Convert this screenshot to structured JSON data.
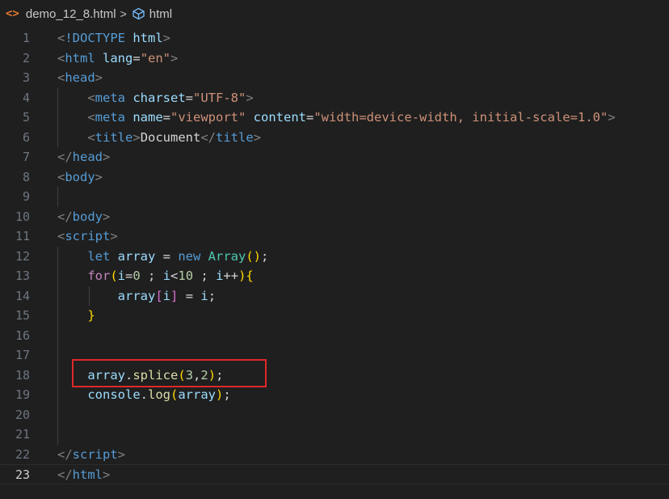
{
  "breadcrumb": {
    "file_icon": "<>",
    "file_name": "demo_12_8.html",
    "separator": ">",
    "element_name": "html"
  },
  "editor": {
    "current_line": 23,
    "highlighted_line": 18,
    "lines": [
      {
        "n": "1",
        "tokens": [
          [
            "t-punct",
            "<"
          ],
          [
            "t-doctype",
            "!DOCTYPE "
          ],
          [
            "t-attr",
            "html"
          ],
          [
            "t-punct",
            ">"
          ]
        ]
      },
      {
        "n": "2",
        "tokens": [
          [
            "t-punct",
            "<"
          ],
          [
            "t-tag",
            "html "
          ],
          [
            "t-attr",
            "lang"
          ],
          [
            "t-text",
            "="
          ],
          [
            "t-str",
            "\"en\""
          ],
          [
            "t-punct",
            ">"
          ]
        ]
      },
      {
        "n": "3",
        "tokens": [
          [
            "t-punct",
            "<"
          ],
          [
            "t-tag",
            "head"
          ],
          [
            "t-punct",
            ">"
          ]
        ]
      },
      {
        "n": "4",
        "tokens": [
          [
            "t-text",
            "    "
          ],
          [
            "t-punct",
            "<"
          ],
          [
            "t-tag",
            "meta "
          ],
          [
            "t-attr",
            "charset"
          ],
          [
            "t-text",
            "="
          ],
          [
            "t-str",
            "\"UTF-8\""
          ],
          [
            "t-punct",
            ">"
          ]
        ]
      },
      {
        "n": "5",
        "tokens": [
          [
            "t-text",
            "    "
          ],
          [
            "t-punct",
            "<"
          ],
          [
            "t-tag",
            "meta "
          ],
          [
            "t-attr",
            "name"
          ],
          [
            "t-text",
            "="
          ],
          [
            "t-str",
            "\"viewport\" "
          ],
          [
            "t-attr",
            "content"
          ],
          [
            "t-text",
            "="
          ],
          [
            "t-str",
            "\"width=device-width, initial-scale=1.0\""
          ],
          [
            "t-punct",
            ">"
          ]
        ]
      },
      {
        "n": "6",
        "tokens": [
          [
            "t-text",
            "    "
          ],
          [
            "t-punct",
            "<"
          ],
          [
            "t-tag",
            "title"
          ],
          [
            "t-punct",
            ">"
          ],
          [
            "t-text",
            "Document"
          ],
          [
            "t-punct",
            "</"
          ],
          [
            "t-tag",
            "title"
          ],
          [
            "t-punct",
            ">"
          ]
        ]
      },
      {
        "n": "7",
        "tokens": [
          [
            "t-punct",
            "</"
          ],
          [
            "t-tag",
            "head"
          ],
          [
            "t-punct",
            ">"
          ]
        ]
      },
      {
        "n": "8",
        "tokens": [
          [
            "t-punct",
            "<"
          ],
          [
            "t-tag",
            "body"
          ],
          [
            "t-punct",
            ">"
          ]
        ]
      },
      {
        "n": "9",
        "tokens": []
      },
      {
        "n": "10",
        "tokens": [
          [
            "t-punct",
            "</"
          ],
          [
            "t-tag",
            "body"
          ],
          [
            "t-punct",
            ">"
          ]
        ]
      },
      {
        "n": "11",
        "tokens": [
          [
            "t-punct",
            "<"
          ],
          [
            "t-tag",
            "script"
          ],
          [
            "t-punct",
            ">"
          ]
        ]
      },
      {
        "n": "12",
        "tokens": [
          [
            "t-text",
            "    "
          ],
          [
            "t-kw",
            "let "
          ],
          [
            "t-var",
            "array "
          ],
          [
            "t-text",
            "= "
          ],
          [
            "t-kw",
            "new "
          ],
          [
            "t-cls",
            "Array"
          ],
          [
            "t-br1",
            "()"
          ],
          [
            "t-text",
            ";"
          ]
        ]
      },
      {
        "n": "13",
        "tokens": [
          [
            "t-text",
            "    "
          ],
          [
            "t-ctl",
            "for"
          ],
          [
            "t-br1",
            "("
          ],
          [
            "t-var",
            "i"
          ],
          [
            "t-text",
            "="
          ],
          [
            "t-num",
            "0"
          ],
          [
            "t-text",
            " ; "
          ],
          [
            "t-var",
            "i"
          ],
          [
            "t-text",
            "<"
          ],
          [
            "t-num",
            "10"
          ],
          [
            "t-text",
            " ; "
          ],
          [
            "t-var",
            "i"
          ],
          [
            "t-text",
            "++"
          ],
          [
            "t-br1",
            ")"
          ],
          [
            "t-br1",
            "{"
          ]
        ]
      },
      {
        "n": "14",
        "tokens": [
          [
            "t-text",
            "        "
          ],
          [
            "t-var",
            "array"
          ],
          [
            "t-br2",
            "["
          ],
          [
            "t-var",
            "i"
          ],
          [
            "t-br2",
            "]"
          ],
          [
            "t-text",
            " = "
          ],
          [
            "t-var",
            "i"
          ],
          [
            "t-text",
            ";"
          ]
        ]
      },
      {
        "n": "15",
        "tokens": [
          [
            "t-text",
            "    "
          ],
          [
            "t-br1",
            "}"
          ]
        ]
      },
      {
        "n": "16",
        "tokens": []
      },
      {
        "n": "17",
        "tokens": []
      },
      {
        "n": "18",
        "tokens": [
          [
            "t-text",
            "    "
          ],
          [
            "t-var",
            "array"
          ],
          [
            "t-text",
            "."
          ],
          [
            "t-fn",
            "splice"
          ],
          [
            "t-br1",
            "("
          ],
          [
            "t-num",
            "3"
          ],
          [
            "t-text",
            ","
          ],
          [
            "t-num",
            "2"
          ],
          [
            "t-br1",
            ")"
          ],
          [
            "t-text",
            ";"
          ]
        ]
      },
      {
        "n": "19",
        "tokens": [
          [
            "t-text",
            "    "
          ],
          [
            "t-var",
            "console"
          ],
          [
            "t-text",
            "."
          ],
          [
            "t-fn",
            "log"
          ],
          [
            "t-br1",
            "("
          ],
          [
            "t-var",
            "array"
          ],
          [
            "t-br1",
            ")"
          ],
          [
            "t-text",
            ";"
          ]
        ]
      },
      {
        "n": "20",
        "tokens": []
      },
      {
        "n": "21",
        "tokens": []
      },
      {
        "n": "22",
        "tokens": [
          [
            "t-punct",
            "</"
          ],
          [
            "t-tag",
            "script"
          ],
          [
            "t-punct",
            ">"
          ]
        ]
      },
      {
        "n": "23",
        "tokens": [
          [
            "t-punct",
            "</"
          ],
          [
            "t-tag",
            "html"
          ],
          [
            "t-punct",
            ">"
          ]
        ]
      }
    ]
  },
  "colors": {
    "background": "#1f1f1f",
    "highlight_box": "#e02828",
    "file_icon": "#e37933"
  }
}
